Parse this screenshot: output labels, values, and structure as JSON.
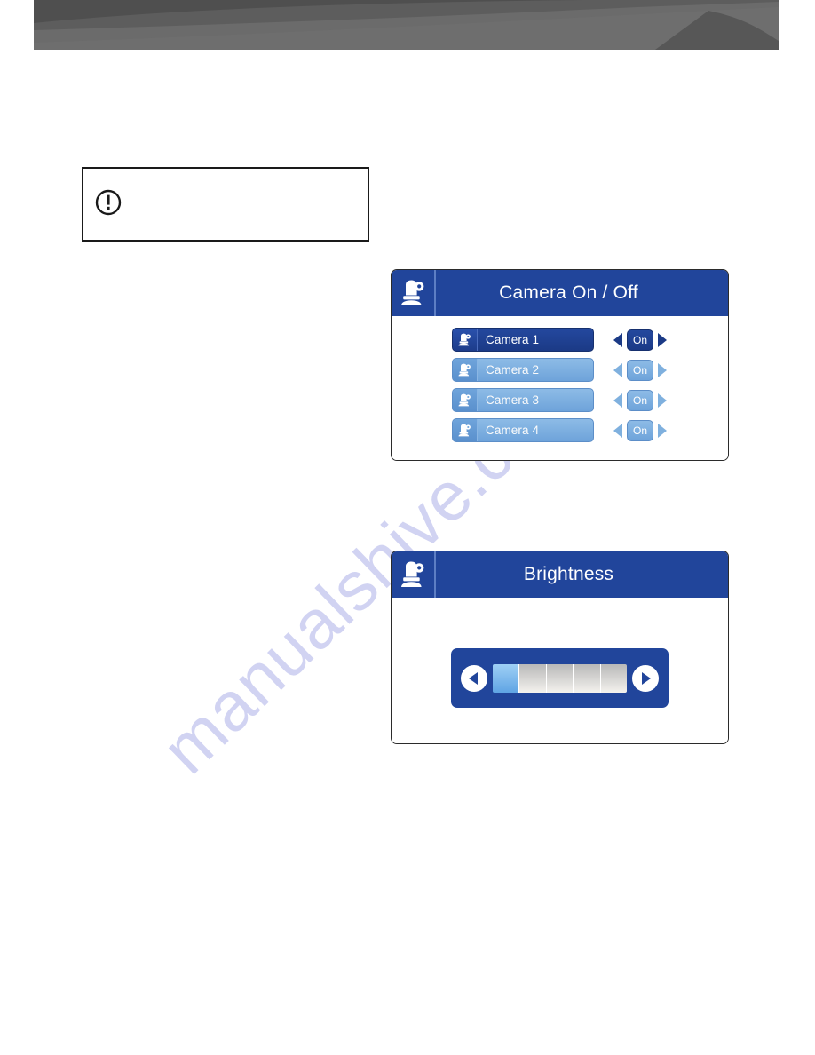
{
  "page": {
    "background_color": "#ffffff",
    "banner_color_dark": "#4d4d4d",
    "banner_color_mid": "#5b5b5b",
    "banner_color_light": "#6e6e6e"
  },
  "watermark": {
    "text": "manualshive.com",
    "color": "#858cde"
  },
  "note_box": {
    "icon": "exclamation-circle-icon",
    "text": ""
  },
  "camera_panel": {
    "title": "Camera  On / Off",
    "title_icon": "ptz-dome-camera-icon",
    "accent_color": "#21459b",
    "rows": [
      {
        "label": "Camera 1",
        "icon": "camera-icon",
        "value": "On",
        "selected": true
      },
      {
        "label": "Camera 2",
        "icon": "camera-icon",
        "value": "On",
        "selected": false
      },
      {
        "label": "Camera 3",
        "icon": "camera-icon",
        "value": "On",
        "selected": false
      },
      {
        "label": "Camera 4",
        "icon": "camera-icon",
        "value": "On",
        "selected": false
      }
    ],
    "left_arrow_icon": "triangle-left-icon",
    "right_arrow_icon": "triangle-right-icon"
  },
  "brightness_panel": {
    "title": "Brightness",
    "title_icon": "ptz-dome-camera-icon",
    "accent_color": "#21459b",
    "slider": {
      "decrease_icon": "circle-arrow-left-icon",
      "increase_icon": "circle-arrow-right-icon",
      "segments_total": 5,
      "segments_filled": 1,
      "fill_color": "#5fa4e4"
    }
  }
}
